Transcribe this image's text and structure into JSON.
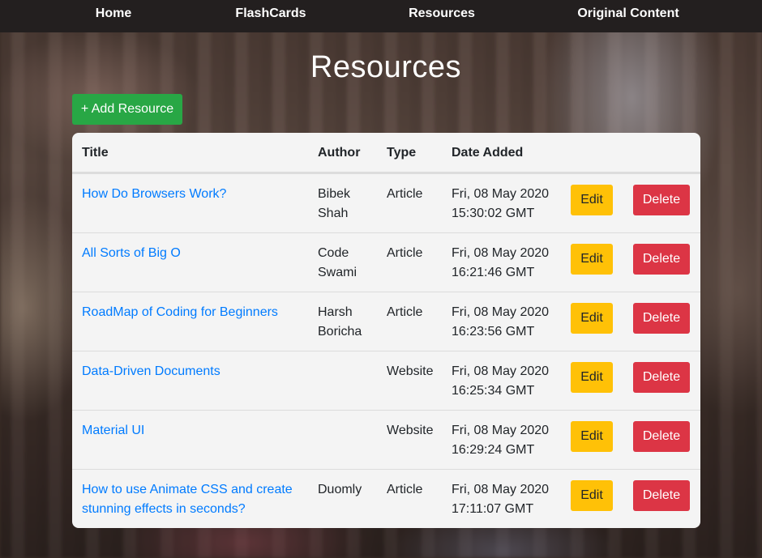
{
  "nav": {
    "items": [
      "Home",
      "FlashCards",
      "Resources",
      "Original Content"
    ]
  },
  "page": {
    "title": "Resources",
    "add_button_label": "+ Add Resource"
  },
  "table": {
    "headers": [
      "Title",
      "Author",
      "Type",
      "Date Added"
    ],
    "edit_label": "Edit",
    "delete_label": "Delete",
    "rows": [
      {
        "title": "How Do Browsers Work?",
        "author": "Bibek Shah",
        "type": "Article",
        "date": "Fri, 08 May 2020 15:30:02 GMT"
      },
      {
        "title": "All Sorts of Big O",
        "author": "Code Swami",
        "type": "Article",
        "date": "Fri, 08 May 2020 16:21:46 GMT"
      },
      {
        "title": "RoadMap of Coding for Beginners",
        "author": "Harsh Boricha",
        "type": "Article",
        "date": "Fri, 08 May 2020 16:23:56 GMT"
      },
      {
        "title": "Data-Driven Documents",
        "author": "",
        "type": "Website",
        "date": "Fri, 08 May 2020 16:25:34 GMT"
      },
      {
        "title": "Material UI",
        "author": "",
        "type": "Website",
        "date": "Fri, 08 May 2020 16:29:24 GMT"
      },
      {
        "title": "How to use Animate CSS and create stunning effects in seconds?",
        "author": "Duomly",
        "type": "Article",
        "date": "Fri, 08 May 2020 17:11:07 GMT"
      }
    ]
  },
  "colors": {
    "nav_bg": "#231f1f",
    "link": "#007bff",
    "add_button": "#28a745",
    "edit_button": "#ffc107",
    "delete_button": "#dc3545"
  }
}
